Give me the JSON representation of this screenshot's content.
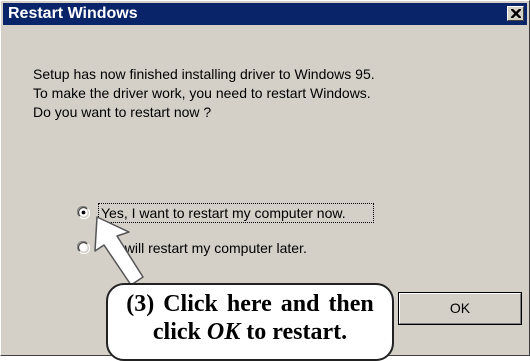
{
  "window": {
    "title": "Restart Windows",
    "close_symbol": "close-icon"
  },
  "message": {
    "line1": "Setup has now finished installing driver to Windows 95.",
    "line2": "To make the driver work, you need to restart Windows.",
    "line3": "Do you want to restart now ?"
  },
  "options": [
    {
      "label": "Yes, I want to restart my computer now.",
      "selected": true
    },
    {
      "label": "I will restart my computer later.",
      "selected": false
    }
  ],
  "buttons": {
    "ok_label": "OK"
  },
  "callout": {
    "line1": "(3) Click here and then",
    "line2_prefix": "click ",
    "line2_emphasis": "OK",
    "line2_suffix": " to restart."
  },
  "colors": {
    "titlebar": "#0a246a",
    "face": "#d4d0c8"
  }
}
